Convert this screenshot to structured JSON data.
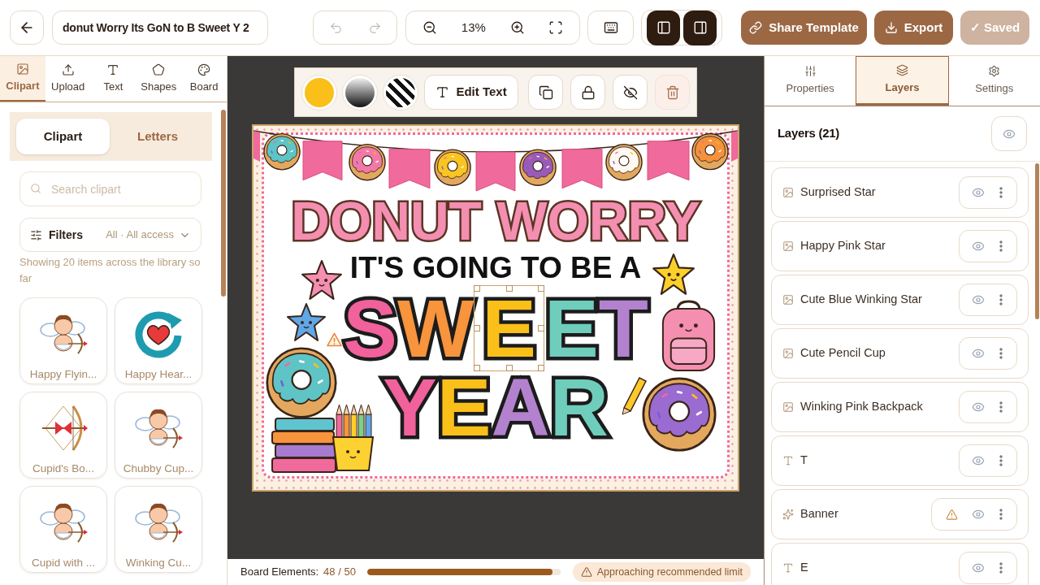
{
  "top_bar": {
    "title": "donut Worry Its GoN to B Sweet Y 2",
    "undo": {
      "disabled": true
    },
    "redo": {
      "disabled": true
    },
    "zoom": "13%",
    "panel_toggles": [
      {
        "on": true
      },
      {
        "on": true
      }
    ],
    "actions": [
      {
        "kind": "share",
        "label": "Share Template",
        "disabled": false
      },
      {
        "kind": "export",
        "label": "Export",
        "disabled": false
      },
      {
        "kind": "saved",
        "label": "✓ Saved",
        "disabled": true
      }
    ]
  },
  "left_panel": {
    "tabs": [
      {
        "label": "Clipart",
        "selected": true
      },
      {
        "label": "Upload",
        "selected": false
      },
      {
        "label": "Text",
        "selected": false
      },
      {
        "label": "Shapes",
        "selected": false
      },
      {
        "label": "Board",
        "selected": false
      }
    ],
    "modes": [
      {
        "label": "Clipart",
        "selected": true
      },
      {
        "label": "Letters",
        "selected": false
      }
    ],
    "search": {
      "placeholder": "Search clipart"
    },
    "filters": {
      "label": "Filters",
      "value": "All · All access"
    },
    "note": "Showing 20 items across the library so far",
    "items": [
      {
        "label": "Happy Flyin..."
      },
      {
        "label": "Happy Hear..."
      },
      {
        "label": "Cupid's Bo..."
      },
      {
        "label": "Chubby Cup..."
      },
      {
        "label": "Cupid with ..."
      },
      {
        "label": "Winking Cu..."
      }
    ]
  },
  "element_toolbar": {
    "swatches": [
      {
        "kind": "solid",
        "color": "#fbbf1a"
      },
      {
        "kind": "gradient"
      },
      {
        "kind": "pattern"
      }
    ],
    "edit_text": "Edit Text"
  },
  "board": {
    "lines": [
      {
        "kind": "title",
        "text": "DONUT WORRY"
      },
      {
        "kind": "subtitle",
        "text": "IT'S GOING TO BE A"
      }
    ],
    "words": [
      {
        "letters": [
          {
            "char": "S",
            "color": "#f1619b",
            "selected": false
          },
          {
            "char": "W",
            "color": "#f7943c",
            "selected": false
          },
          {
            "char": "E",
            "color": "#fbbf1a",
            "selected": true
          },
          {
            "char": "E",
            "color": "#6fcdbc",
            "selected": false
          },
          {
            "char": "T",
            "color": "#b382cf",
            "selected": false
          }
        ]
      },
      {
        "letters": [
          {
            "char": "Y",
            "color": "#f1619b",
            "selected": false
          },
          {
            "char": "E",
            "color": "#fbbf1a",
            "selected": false
          },
          {
            "char": "A",
            "color": "#b382cf",
            "selected": false
          },
          {
            "char": "R",
            "color": "#6fcdbc",
            "selected": false
          }
        ]
      }
    ]
  },
  "status_bar": {
    "label": "Board Elements:",
    "count": "48 / 50",
    "level": 0.96,
    "warning": "Approaching recommended limit"
  },
  "right_panel": {
    "tabs": [
      {
        "label": "Properties",
        "selected": false
      },
      {
        "label": "Layers",
        "selected": true
      },
      {
        "label": "Settings",
        "selected": false
      }
    ],
    "title": "Layers (21)",
    "layers": [
      {
        "kind": "image",
        "name": "Surprised Star",
        "warning": false
      },
      {
        "kind": "image",
        "name": "Happy Pink Star",
        "warning": false
      },
      {
        "kind": "image",
        "name": "Cute Blue Winking Star",
        "warning": false
      },
      {
        "kind": "image",
        "name": "Cute Pencil Cup",
        "warning": false
      },
      {
        "kind": "image",
        "name": "Winking Pink Backpack",
        "warning": false
      },
      {
        "kind": "text",
        "name": "T",
        "warning": false
      },
      {
        "kind": "effect",
        "name": "Banner",
        "warning": true
      },
      {
        "kind": "text",
        "name": "E",
        "warning": false
      }
    ]
  }
}
